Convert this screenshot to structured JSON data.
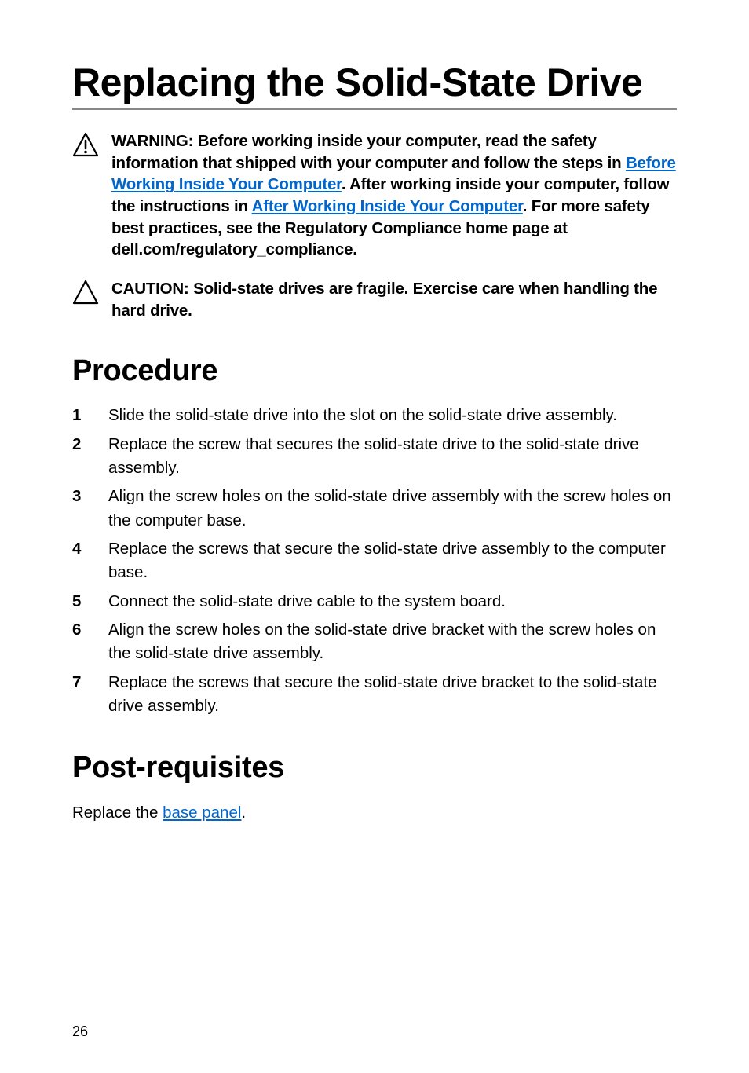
{
  "title": "Replacing the Solid-State Drive",
  "callouts": {
    "warning": {
      "intro": "WARNING: Before working inside your computer, read the safety information that shipped with your computer and follow the steps in ",
      "link1": "Before Working Inside Your Computer",
      "mid": ". After working inside your computer, follow the instructions in ",
      "link2": "After Working Inside Your Computer",
      "tail": ". For more safety best practices, see the Regulatory Compliance home page at dell.com/regulatory_compliance."
    },
    "caution": "CAUTION: Solid-state drives are fragile. Exercise care when handling the hard drive."
  },
  "procedure": {
    "heading": "Procedure",
    "steps": [
      "Slide the solid-state drive into the slot on the solid-state drive assembly.",
      "Replace the screw that secures the solid-state drive to the solid-state drive assembly.",
      "Align the screw holes on the solid-state drive assembly with the screw holes on the computer base.",
      "Replace the screws that secure the solid-state drive assembly to the computer base.",
      "Connect the solid-state drive cable to the system board.",
      "Align the screw holes on the solid-state drive bracket with the screw holes on the solid-state drive assembly.",
      "Replace the screws that secure the solid-state drive bracket to the solid-state drive assembly."
    ]
  },
  "post": {
    "heading": "Post-requisites",
    "text_before": "Replace the ",
    "link": "base panel",
    "text_after": "."
  },
  "page_number": "26"
}
